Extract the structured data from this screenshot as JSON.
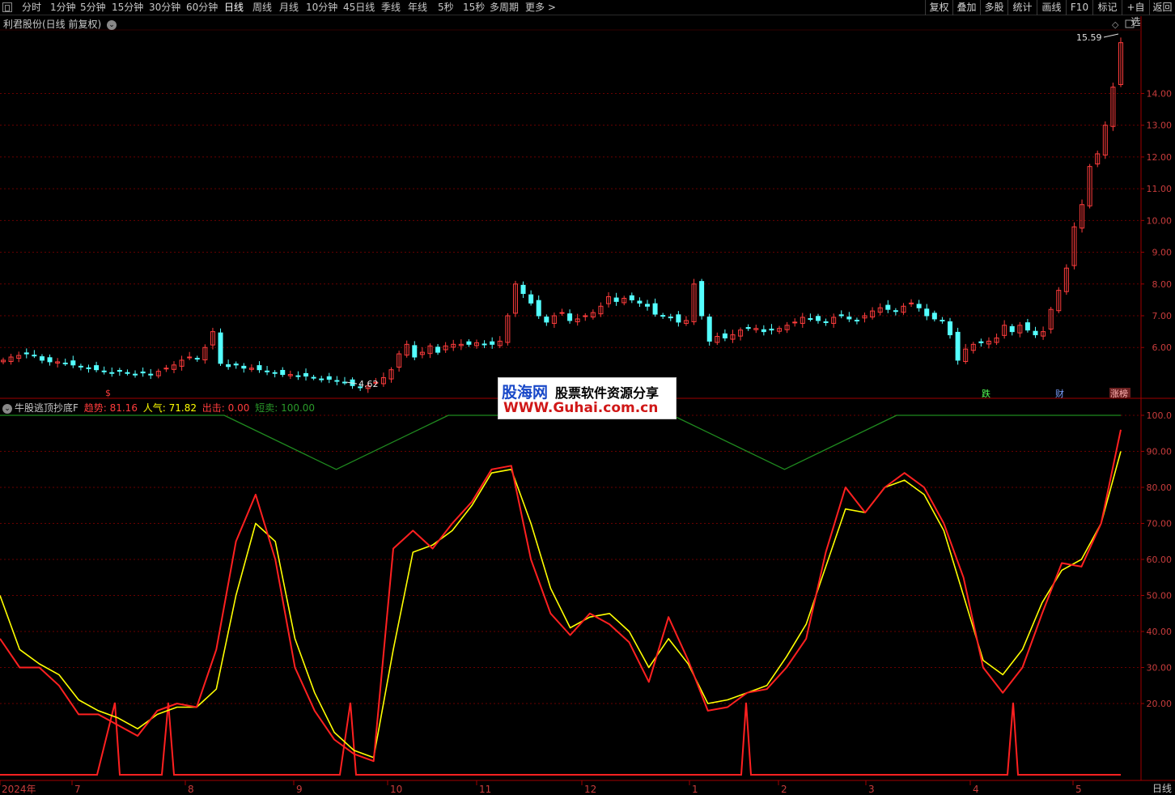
{
  "toolbar": {
    "periods": [
      "分时",
      "1分钟",
      "5分钟",
      "15分钟",
      "30分钟",
      "60分钟",
      "日线",
      "周线",
      "月线",
      "10分钟",
      "45日线",
      "季线",
      "年线",
      "5秒",
      "15秒",
      "多周期",
      "更多 >"
    ],
    "active_period": "日线",
    "right_buttons": [
      "复权",
      "叠加",
      "多股",
      "统计",
      "画线",
      "F10",
      "标记",
      "+自选",
      "返回"
    ]
  },
  "main_chart": {
    "title": "利君股份(日线 前复权)",
    "max_label": "15.59",
    "min_label": "4.62",
    "price_axis": [
      "14.00",
      "13.00",
      "12.00",
      "11.00",
      "10.00",
      "9.00",
      "8.00",
      "7.00",
      "6.00"
    ],
    "markers": {
      "bottom_left": "$",
      "tag1": "跌",
      "tag2": "财",
      "tag3": "涨榜"
    },
    "colors": {
      "up": "#ff3c3c",
      "down": "#54ffff",
      "grid": "#6a0000",
      "axis": "#a00000"
    }
  },
  "indicator": {
    "name": "牛股逃顶抄底F",
    "values": [
      {
        "label": "趋势:",
        "value": "81.16",
        "color": "#ff3c3c"
      },
      {
        "label": "人气:",
        "value": "71.82",
        "color": "#ffff00"
      },
      {
        "label": "出击:",
        "value": "0.00",
        "color": "#ff3c3c"
      },
      {
        "label": "短卖:",
        "value": "100.00",
        "color": "#2a9a2a"
      }
    ],
    "axis": [
      "100.0",
      "90.00",
      "80.00",
      "70.00",
      "60.00",
      "50.00",
      "40.00",
      "30.00",
      "20.00"
    ]
  },
  "x_axis": {
    "labels": [
      "2024年",
      "7",
      "8",
      "9",
      "10",
      "11",
      "12",
      "1",
      "2",
      "3",
      "4",
      "5"
    ],
    "period_label": "日线"
  },
  "watermark": {
    "logo": "股海网",
    "text": "股票软件资源分享",
    "url": "WWW.Guhai.com.cn"
  },
  "chart_data": [
    {
      "type": "candlestick",
      "title": "利君股份(日线 前复权)",
      "y_range": [
        4.4,
        16.0
      ],
      "series": [
        {
          "name": "close",
          "values": [
            5.6,
            5.7,
            5.75,
            5.8,
            5.75,
            5.6,
            5.55,
            5.55,
            5.5,
            5.45,
            5.4,
            5.35,
            5.3,
            5.25,
            5.2,
            5.25,
            5.2,
            5.15,
            5.2,
            5.15,
            5.25,
            5.35,
            5.45,
            5.6,
            5.7,
            5.65,
            6.0,
            6.5,
            5.5,
            5.4,
            5.45,
            5.35,
            5.35,
            5.3,
            5.25,
            5.2,
            5.15,
            5.15,
            5.1,
            5.1,
            5.05,
            5.0,
            5.0,
            4.95,
            4.9,
            4.8,
            4.75,
            4.8,
            4.9,
            5.05,
            5.3,
            5.8,
            6.1,
            5.7,
            5.85,
            6.05,
            5.85,
            6.05,
            6.1,
            6.1,
            6.1,
            6.15,
            6.1,
            6.1,
            6.2,
            7.0,
            8.0,
            7.7,
            7.4,
            7.0,
            6.8,
            7.0,
            7.1,
            6.85,
            6.9,
            7.0,
            7.1,
            7.3,
            7.6,
            7.45,
            7.55,
            7.5,
            7.4,
            7.3,
            7.05,
            7.0,
            6.95,
            6.8,
            6.85,
            8.0,
            7.0,
            6.2,
            6.35,
            6.3,
            6.4,
            6.55,
            6.6,
            6.6,
            6.5,
            6.55,
            6.6,
            6.7,
            6.8,
            6.95,
            6.9,
            6.85,
            6.8,
            6.95,
            7.0,
            6.9,
            6.85,
            7.0,
            7.15,
            7.25,
            7.2,
            7.15,
            7.3,
            7.4,
            7.25,
            7.0,
            6.9,
            6.85,
            6.4,
            5.6,
            5.95,
            6.1,
            6.15,
            6.2,
            6.3,
            6.7,
            6.5,
            6.7,
            6.55,
            6.4,
            6.5,
            7.2,
            7.8,
            8.5,
            9.8,
            10.5,
            11.7,
            12.1,
            13.0,
            14.2,
            15.6
          ]
        }
      ]
    },
    {
      "type": "line",
      "title": "牛股逃顶抄底F",
      "y_range": [
        0,
        100
      ],
      "series": [
        {
          "name": "趋势",
          "values": [
            38,
            30,
            30,
            25,
            17,
            17,
            14,
            11,
            18,
            20,
            19,
            35,
            65,
            78,
            60,
            30,
            18,
            10,
            6,
            4,
            63,
            68,
            63,
            70,
            76,
            85,
            86,
            60,
            45,
            39,
            45,
            42,
            37,
            26,
            44,
            32,
            18,
            19,
            23,
            24,
            30,
            38,
            62,
            80,
            73,
            80,
            84,
            80,
            70,
            55,
            30,
            23,
            30,
            45,
            59,
            58,
            70,
            96
          ]
        },
        {
          "name": "人气",
          "values": [
            50,
            35,
            31,
            28,
            21,
            18,
            16,
            13,
            17,
            19,
            19,
            24,
            50,
            70,
            65,
            38,
            23,
            12,
            7,
            5,
            35,
            62,
            64,
            68,
            75,
            84,
            85,
            70,
            52,
            41,
            44,
            45,
            40,
            30,
            38,
            31,
            20,
            21,
            23,
            25,
            33,
            42,
            58,
            74,
            73,
            80,
            82,
            78,
            68,
            50,
            32,
            28,
            35,
            48,
            57,
            60,
            70,
            90
          ]
        },
        {
          "name": "出击",
          "values": [
            0,
            0,
            20,
            0,
            0,
            20,
            0,
            0,
            0,
            20,
            0,
            0,
            0,
            0,
            0,
            0,
            0,
            20,
            0,
            0,
            0,
            0,
            0,
            0,
            0,
            0,
            0,
            0,
            20,
            0,
            0,
            0,
            0
          ]
        },
        {
          "name": "短卖",
          "values": [
            100,
            100,
            100,
            85,
            100,
            100,
            100,
            85,
            100,
            100,
            100
          ]
        }
      ]
    }
  ]
}
